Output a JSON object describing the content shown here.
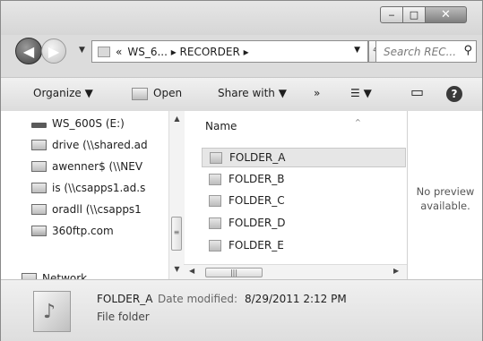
{
  "window": {
    "minimize_glyph": "‒",
    "maximize_glyph": "□",
    "close_glyph": "✕"
  },
  "address": {
    "prefix": "«",
    "path": "WS_6... ▸ RECORDER ▸",
    "dropdown_glyph": "▼",
    "refresh_glyph": "⁴↑"
  },
  "search": {
    "placeholder": "Search REC...",
    "icon": "search-icon",
    "glyph": "⚲"
  },
  "nav": {
    "back_glyph": "◀",
    "forward_glyph": "▶",
    "recent_glyph": "▼"
  },
  "toolbar": {
    "organize": "Organize ▼",
    "open": "Open",
    "share_with": "Share with ▼",
    "more": "»",
    "views_glyph": "☰ ▼",
    "preview_glyph": "▭",
    "help_glyph": "?"
  },
  "navpane": {
    "items": [
      {
        "label": "WS_600S (E:)",
        "icon": "drive-icon"
      },
      {
        "label": "drive (\\\\shared.ad",
        "icon": "network-drive-icon"
      },
      {
        "label": "awenner$ (\\\\NEV",
        "icon": "network-drive-icon"
      },
      {
        "label": "is (\\\\csapps1.ad.s",
        "icon": "network-drive-icon"
      },
      {
        "label": "oradll (\\\\csapps1",
        "icon": "network-drive-icon"
      },
      {
        "label": "360ftp.com",
        "icon": "ftp-location-icon"
      },
      {
        "label": "Network",
        "icon": "network-icon"
      }
    ]
  },
  "filepane": {
    "column_header": "Name",
    "sort_glyph": "^",
    "files": [
      {
        "name": "FOLDER_A",
        "selected": true
      },
      {
        "name": "FOLDER_B",
        "selected": false
      },
      {
        "name": "FOLDER_C",
        "selected": false
      },
      {
        "name": "FOLDER_D",
        "selected": false
      },
      {
        "name": "FOLDER_E",
        "selected": false
      }
    ]
  },
  "scroll": {
    "up": "▲",
    "down": "▼",
    "left": "◀",
    "right": "▶",
    "grip": "≡",
    "hgrip": "|||"
  },
  "preview": {
    "line1": "No preview",
    "line2": "available."
  },
  "details": {
    "name": "FOLDER_A",
    "date_label": "Date modified:",
    "date_value": "8/29/2011 2:12 PM",
    "type": "File folder",
    "icon_glyph": "♪"
  }
}
